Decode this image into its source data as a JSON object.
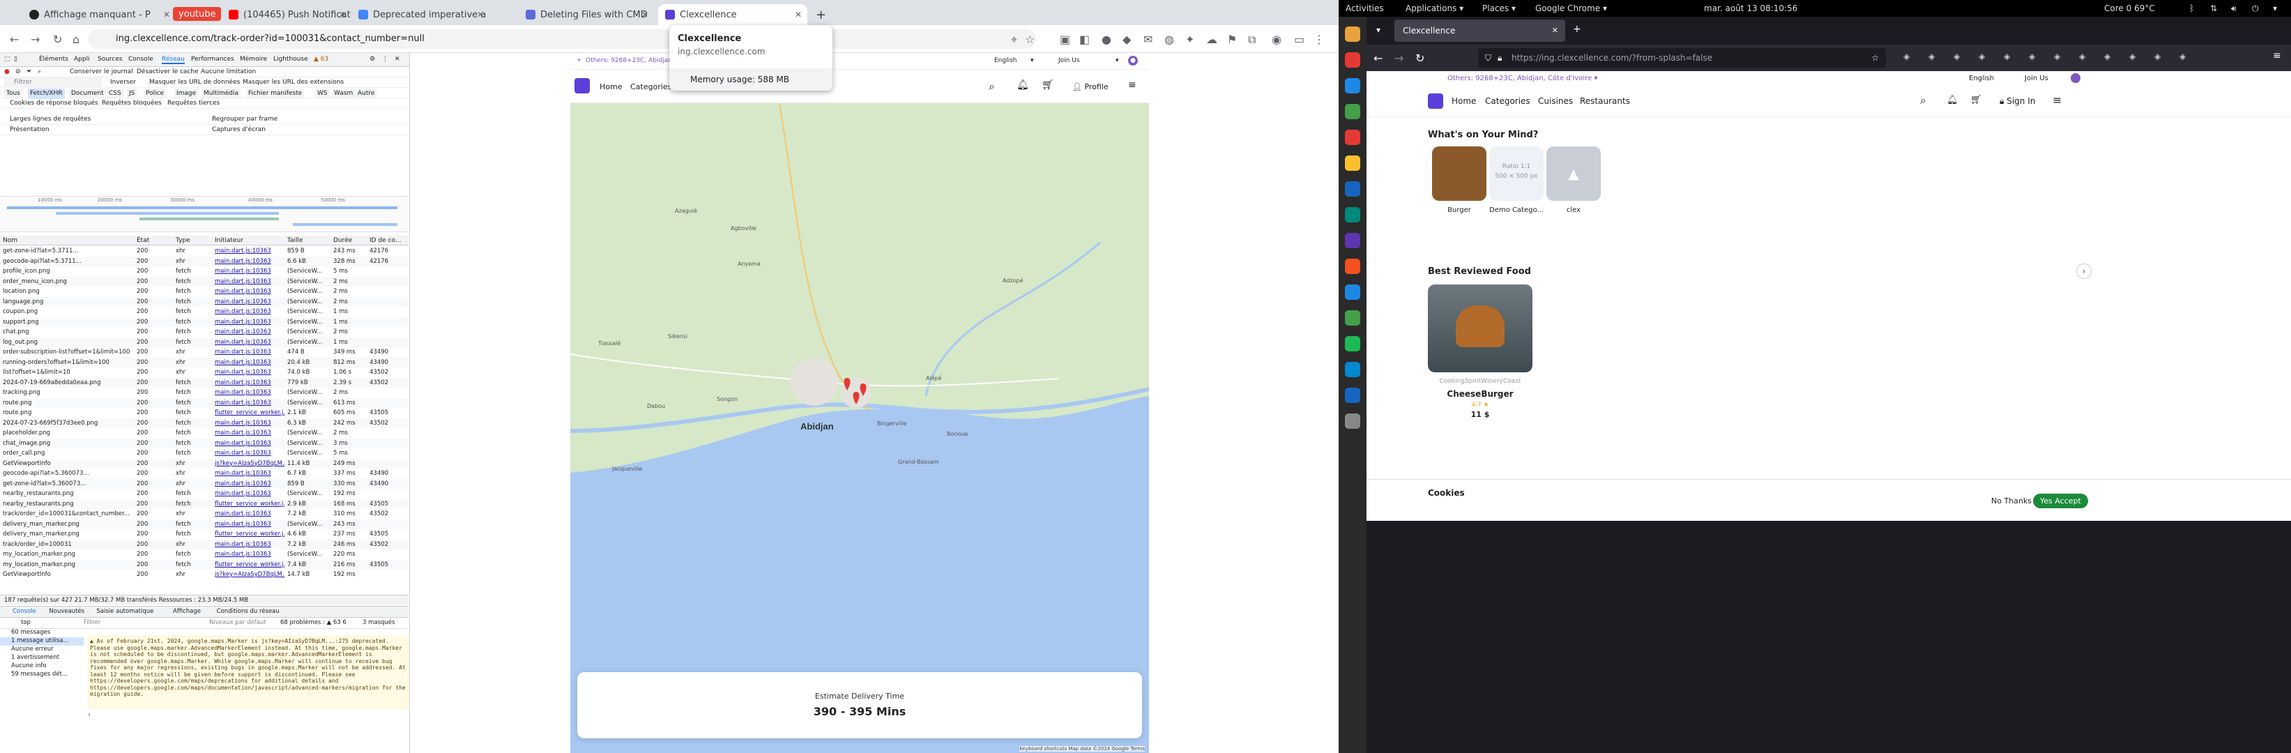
{
  "chrome": {
    "tabs": [
      {
        "label": "Affichage manquant - P",
        "active": false
      },
      {
        "label": "youtube",
        "active": false
      },
      {
        "label": "(104465) Push Notificat",
        "active": false
      },
      {
        "label": "Deprecated imperative a",
        "active": false
      },
      {
        "label": "Deleting Files with CMD",
        "active": false
      },
      {
        "label": "Clexcellence",
        "active": true
      }
    ],
    "url": "ing.clexcellence.com/track-order?id=100031&contact_number=null",
    "tooltip": {
      "title": "Clexcellence",
      "domain": "ing.clexcellence.com",
      "memory": "Memory usage: 588 MB"
    }
  },
  "devtools": {
    "tabs": [
      "Éléments",
      "Appli",
      "Sources",
      "Console",
      "Réseau",
      "Performances",
      "Mémoire",
      "Lighthouse"
    ],
    "warning_count": "▲ 63",
    "toolbar": {
      "preserve": "Conserver le journal",
      "disable_cache": "Désactiver le cache",
      "throttle": "Aucune limitation"
    },
    "filter_placeholder": "Filtrer",
    "filter_opts": [
      "Inverser",
      "Masquer les URL de données",
      "Masquer les URL des extensions"
    ],
    "type_filters": [
      "Tous",
      "Fetch/XHR",
      "Document",
      "CSS",
      "JS",
      "Police",
      "Image",
      "Multimédia",
      "Fichier manifeste",
      "WS",
      "Wasm",
      "Autre"
    ],
    "extra_opts": [
      "Cookies de réponse bloqués",
      "Requêtes bloquées",
      "Requêtes tierces"
    ],
    "opts2": [
      "Larges lignes de requêtes",
      "Regrouper par frame",
      "Présentation",
      "Captures d'écran"
    ],
    "timeline_ticks": [
      "10000 ms",
      "20000 ms",
      "30000 ms",
      "40000 ms",
      "50000 ms"
    ],
    "columns": [
      "Nom",
      "État",
      "Type",
      "Initiateur",
      "Taille",
      "Durée",
      "ID de co..."
    ],
    "rows": [
      [
        "get-zone-id?lat=5.3711...",
        "200",
        "xhr",
        "main.dart.js:10363",
        "859 B",
        "243 ms",
        "42176"
      ],
      [
        "geocode-api?lat=5.3711...",
        "200",
        "xhr",
        "main.dart.js:10363",
        "6.6 kB",
        "328 ms",
        "42176"
      ],
      [
        "profile_icon.png",
        "200",
        "fetch",
        "main.dart.js:10363",
        "(ServiceW...",
        "5 ms",
        ""
      ],
      [
        "order_menu_icon.png",
        "200",
        "fetch",
        "main.dart.js:10363",
        "(ServiceW...",
        "2 ms",
        ""
      ],
      [
        "location.png",
        "200",
        "fetch",
        "main.dart.js:10363",
        "(ServiceW...",
        "2 ms",
        ""
      ],
      [
        "language.png",
        "200",
        "fetch",
        "main.dart.js:10363",
        "(ServiceW...",
        "2 ms",
        ""
      ],
      [
        "coupon.png",
        "200",
        "fetch",
        "main.dart.js:10363",
        "(ServiceW...",
        "1 ms",
        ""
      ],
      [
        "support.png",
        "200",
        "fetch",
        "main.dart.js:10363",
        "(ServiceW...",
        "1 ms",
        ""
      ],
      [
        "chat.png",
        "200",
        "fetch",
        "main.dart.js:10363",
        "(ServiceW...",
        "2 ms",
        ""
      ],
      [
        "log_out.png",
        "200",
        "fetch",
        "main.dart.js:10363",
        "(ServiceW...",
        "1 ms",
        ""
      ],
      [
        "order-subscription-list?offset=1&limit=100",
        "200",
        "xhr",
        "main.dart.js:10363",
        "474 B",
        "349 ms",
        "43490"
      ],
      [
        "running-orders?offset=1&limit=100",
        "200",
        "xhr",
        "main.dart.js:10363",
        "20.4 kB",
        "812 ms",
        "43490"
      ],
      [
        "list?offset=1&limit=10",
        "200",
        "xhr",
        "main.dart.js:10363",
        "74.0 kB",
        "1.06 s",
        "43502"
      ],
      [
        "2024-07-19-669a8edda0eaa.png",
        "200",
        "fetch",
        "main.dart.js:10363",
        "779 kB",
        "2.39 s",
        "43502"
      ],
      [
        "tracking.png",
        "200",
        "fetch",
        "main.dart.js:10363",
        "(ServiceW...",
        "2 ms",
        ""
      ],
      [
        "route.png",
        "200",
        "fetch",
        "main.dart.js:10363",
        "(ServiceW...",
        "613 ms",
        ""
      ],
      [
        "route.png",
        "200",
        "fetch",
        "flutter_service_worker.j...",
        "2.1 kB",
        "605 ms",
        "43505"
      ],
      [
        "2024-07-23-669f5f37d3ee0.png",
        "200",
        "fetch",
        "main.dart.js:10363",
        "6.3 kB",
        "242 ms",
        "43502"
      ],
      [
        "placeholder.png",
        "200",
        "fetch",
        "main.dart.js:10363",
        "(ServiceW...",
        "2 ms",
        ""
      ],
      [
        "chat_image.png",
        "200",
        "fetch",
        "main.dart.js:10363",
        "(ServiceW...",
        "3 ms",
        ""
      ],
      [
        "order_call.png",
        "200",
        "fetch",
        "main.dart.js:10363",
        "(ServiceW...",
        "5 ms",
        ""
      ],
      [
        "GetViewportInfo",
        "200",
        "xhr",
        "js?key=AIzaSyD7BqLM...",
        "11.4 kB",
        "249 ms",
        ""
      ],
      [
        "geocode-api?lat=5.360073...",
        "200",
        "xhr",
        "main.dart.js:10363",
        "6.7 kB",
        "337 ms",
        "43490"
      ],
      [
        "get-zone-id?lat=5.360073...",
        "200",
        "xhr",
        "main.dart.js:10363",
        "859 B",
        "330 ms",
        "43490"
      ],
      [
        "nearby_restaurants.png",
        "200",
        "fetch",
        "main.dart.js:10363",
        "(ServiceW...",
        "192 ms",
        ""
      ],
      [
        "nearby_restaurants.png",
        "200",
        "fetch",
        "flutter_service_worker.j...",
        "2.9 kB",
        "168 ms",
        "43505"
      ],
      [
        "track/order_id=100031&contact_number...",
        "200",
        "xhr",
        "main.dart.js:10363",
        "7.2 kB",
        "310 ms",
        "43502"
      ],
      [
        "delivery_man_marker.png",
        "200",
        "fetch",
        "main.dart.js:10363",
        "(ServiceW...",
        "243 ms",
        ""
      ],
      [
        "delivery_man_marker.png",
        "200",
        "fetch",
        "flutter_service_worker.j...",
        "4.6 kB",
        "237 ms",
        "43505"
      ],
      [
        "track/order_id=100031",
        "200",
        "xhr",
        "main.dart.js:10363",
        "7.2 kB",
        "246 ms",
        "43502"
      ],
      [
        "my_location_marker.png",
        "200",
        "fetch",
        "main.dart.js:10363",
        "(ServiceW...",
        "220 ms",
        ""
      ],
      [
        "my_location_marker.png",
        "200",
        "fetch",
        "flutter_service_worker.j...",
        "7.4 kB",
        "216 ms",
        "43505"
      ],
      [
        "GetViewportInfo",
        "200",
        "xhr",
        "js?key=AIzaSyD7BqLM...",
        "14.7 kB",
        "192 ms",
        ""
      ]
    ],
    "status": "187 requête(s) sur 427    21.7 MB/32.7 MB transférés    Ressources : 23.3 MB/24.5 MB",
    "drawer_tabs": [
      "Console",
      "Nouveautés",
      "Saisie automatique",
      "Affichage",
      "Conditions du réseau"
    ],
    "console_ctx": "top",
    "console_filter": "Filtrer",
    "levels": "Niveaux par défaut",
    "problems": "68 problèmes : ▲ 63  6",
    "hidden": "3 masqués",
    "sidebar": [
      "60 messages",
      "1 message utilisa...",
      "Aucune erreur",
      "1 avertissement",
      "Aucune info",
      "59 messages dét..."
    ],
    "warning": "▲ As of February 21st, 2024, google.maps.Marker is js?key=AIzaSyD7BqLM...:275 deprecated. Please use google.maps.marker.AdvancedMarkerElement instead. At this time, google.maps.Marker is not scheduled to be discontinued, but google.maps.marker.AdvancedMarkerElement is recommended over google.maps.Marker. While google.maps.Marker will continue to receive bug fixes for any major regressions, existing bugs in google.maps.Marker will not be addressed. At least 12 months notice will be given before support is discontinued. Please see https://developers.google.com/maps/deprecations for additional details and https://developers.google.com/maps/documentation/javascript/advanced-markers/migration for the migration guide."
  },
  "site": {
    "others": "Others: 9268+23C, Abidjan",
    "language": "English",
    "join": "Join Us",
    "nav": [
      "Home",
      "Categories"
    ],
    "profile": "Profile",
    "map_city": "Abidjan",
    "map_places": [
      "Agboville",
      "Azaguié",
      "Anyama",
      "Bingerville",
      "Grand-Bassam",
      "Dabou",
      "Jacqueville",
      "Alépé",
      "Bonoua",
      "Adzopé",
      "Tiassalé",
      "Sikensi",
      "Songon"
    ],
    "estimate_label": "Estimate Delivery Time",
    "estimate_value": "390 - 395 Mins",
    "map_footer": "Keyboard shortcuts   Map data ©2024 Google   Terms"
  },
  "gnome": {
    "activities": "Activities",
    "applications": "Applications ▾",
    "places": "Places ▾",
    "app": "Google Chrome ▾",
    "clock": "mar. août 13  08:10:56",
    "cpu": "Core 0 69°C"
  },
  "firefox": {
    "tab": "Clexcellence",
    "url": "https://ing.clexcellence.com/?from-splash=false",
    "others": "Others: 9268+23C, Abidjan, Côte d'Ivoire ▾",
    "language": "English",
    "join": "Join Us",
    "nav": [
      "Home",
      "Categories",
      "Cuisines",
      "Restaurants"
    ],
    "signin": "Sign In",
    "mind_title": "What's on Your Mind?",
    "categories": [
      "Burger",
      "Demo Catego...",
      "clex"
    ],
    "ratio_text": "Ratio 1:1",
    "ratio_size": "500 × 500 px",
    "best_title": "Best Reviewed Food",
    "food_restaurant": "CookingSpiritWineryCoast",
    "food_name": "CheeseBurger",
    "food_rating": "4.7 ★",
    "food_price": "11 $",
    "cookies_title": "Cookies",
    "no_thanks": "No Thanks",
    "yes_accept": "Yes Accept"
  }
}
